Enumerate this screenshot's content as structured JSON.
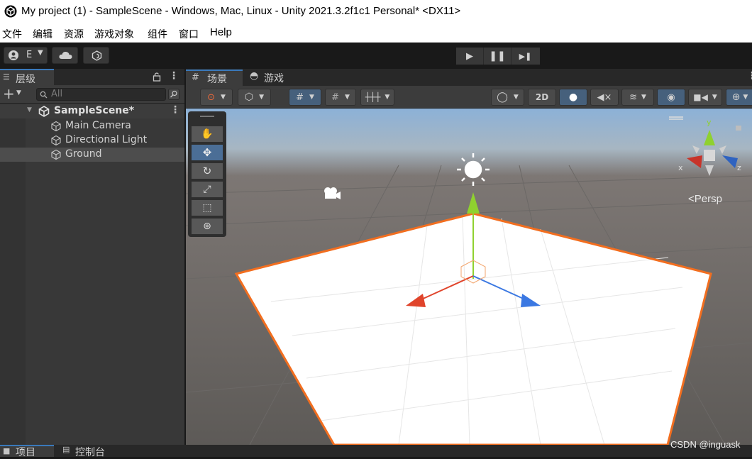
{
  "window": {
    "title": "My project (1) - SampleScene - Windows, Mac, Linux - Unity 2021.3.2f1c1 Personal* <DX11>"
  },
  "menu": [
    "文件",
    "编辑",
    "资源",
    "游戏对象",
    "组件",
    "窗口",
    "Help"
  ],
  "toolbar": {
    "account_label": "E",
    "play_icon": "play-icon",
    "pause_icon": "pause-icon",
    "step_icon": "step-icon"
  },
  "hierarchy": {
    "tab_label": "层级",
    "search_placeholder": "All",
    "scene_name": "SampleScene*",
    "items": [
      "Main Camera",
      "Directional Light",
      "Ground"
    ],
    "selected_item": "Ground"
  },
  "scene_view": {
    "tabs": [
      "场景",
      "游戏"
    ],
    "active_tab": "场景",
    "toggle_2d": "2D",
    "projection_label": "Persp",
    "gizmo_axes": {
      "x": "x",
      "y": "y",
      "z": "z"
    }
  },
  "bottom": {
    "tabs": [
      "项目",
      "控制台"
    ]
  },
  "watermark": "CSDN @inguask",
  "colors": {
    "accent": "#3a79bb",
    "selection_outline": "#f26e1f",
    "x_axis": "#e0442b",
    "y_axis": "#8fd12f",
    "z_axis": "#3b78e2"
  }
}
